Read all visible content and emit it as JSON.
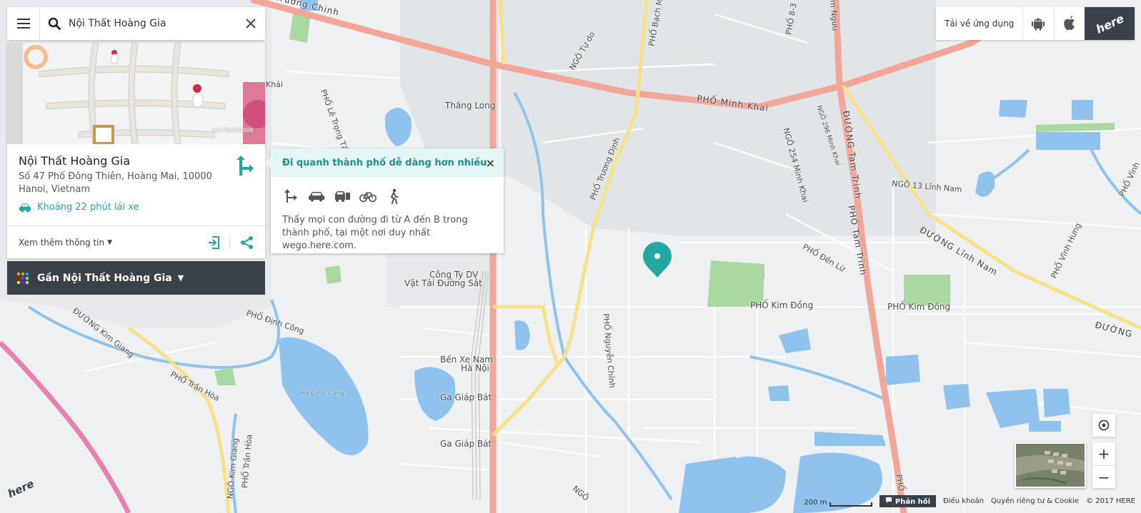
{
  "search": {
    "value": "Nội Thất Hoàng Gia",
    "placeholder": ""
  },
  "place": {
    "photo_credit": "via Facebook",
    "name": "Nội Thất Hoàng Gia",
    "address": "Số 47 Phố Đông Thiên, Hoàng Mai, 10000 Hanoi, Vietnam",
    "drive_time": "Khoảng 22 phút lái xe",
    "more_info": "Xem thêm thông tin"
  },
  "nearby": {
    "label": "Gần Nội Thất Hoàng Gia"
  },
  "promo": {
    "title": "Đi quanh thành phố dễ dàng hơn nhiều",
    "close": "×",
    "text": "Thấy mọi con đường đi từ A đến B trong thành phố, tại một nơi duy nhất wego.here.com."
  },
  "app_bar": {
    "label": "Tải về ứng dụng",
    "logo": "here"
  },
  "map": {
    "labels": {
      "truong_chinh": "Trường Chinh",
      "minh_khai": "PHỐ Minh Khai",
      "thang_long": "Thăng Long",
      "tam_trinh": "ĐƯỜNG Tam Trinh",
      "pho_tam_trinh": "PHỐ Tam Trinh",
      "linh_nam_13": "NGÕ 13 Lĩnh Nam",
      "duong_linh_nam": "ĐƯỜNG Lĩnh Nam",
      "ngo_254": "NGÕ 254 Minh Khai",
      "ngo_296": "NGÕ 296 Minh Khai",
      "den_lu": "PHỐ Đền Lừ",
      "vinh_hung": "PHỐ Vĩnh Hưng",
      "kim_dong_1": "PHỐ Kim Đồng",
      "kim_dong_2": "PHỐ Kim Đồng",
      "cong_ty_1": "Công Ty DV",
      "cong_ty_2": "Vật Tải Đường Sắt",
      "dinh_cong": "PHỐ Định Công",
      "kim_giang": "ĐƯỜNG Kim Giang",
      "tran_hoa": "PHỐ Trần Hòa",
      "ben_xe_1": "Bến Xe Nam",
      "ben_xe_2": "Hà Nội",
      "ga_giap_bat_1": "Ga Giáp Bát",
      "ga_giap_bat_2": "Ga Giáp Bát",
      "ho_dinh_cong": "Hồ Định Công",
      "truong_dinh": "PHỐ Trương Định",
      "nguyen_chinh": "PHỐ Nguyễn Chính",
      "le_trong_tan": "PHỐ Lê Trọng Tấn",
      "ngo_tu_do": "NGÕ Tự do",
      "pho_83": "PHỐ 8-3",
      "kim_nguu": "Kim Ngưu",
      "pho_bach": "PHỐ Bạch Mai",
      "duong_right": "ĐƯỜNG",
      "pho_vinh": "PHỐ Vĩnh",
      "kim_giang_v": "NGÕ Kim Giang",
      "tran_hoa_v": "PHỐ Trần Hòa",
      "pho_bottom": "PHỐ",
      "ngo_bottom": "NGÕ",
      "khai": "Khải"
    },
    "logo": "here"
  },
  "controls": {
    "zoom_in": "+",
    "zoom_out": "−"
  },
  "footer": {
    "scale": "200 m",
    "feedback": "Phản hồi",
    "terms": "Điều khoản",
    "privacy": "Quyền riêng tư & Cookie",
    "copyright": "© 2017 HERE"
  },
  "colors": {
    "accent": "#24a6a1",
    "dark_bar": "#3b4149",
    "major_road": "#f2a69a",
    "yellow_road": "#f7e28a",
    "water": "#8fc3ee",
    "park": "#a9d9a0",
    "railway": "#e87fb1"
  }
}
